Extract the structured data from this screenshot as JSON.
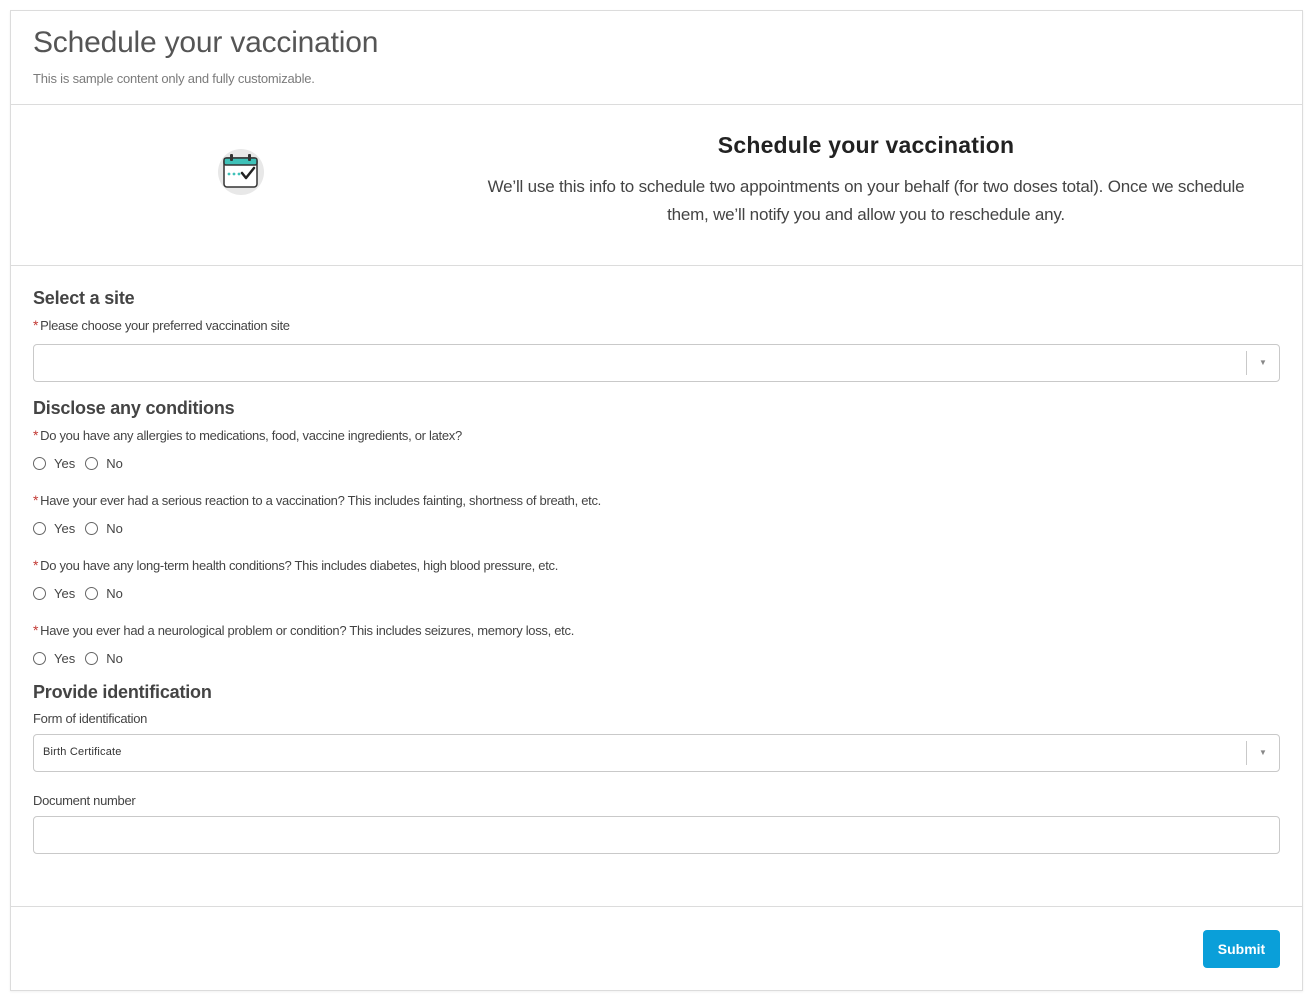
{
  "header": {
    "title": "Schedule your vaccination",
    "subtitle": "This is sample content only and fully customizable."
  },
  "hero": {
    "icon": "calendar-check-icon",
    "title": "Schedule your vaccination",
    "description": "We’ll use this info to schedule two appointments on your behalf (for two doses total). Once we schedule them, we’ll notify you and allow you to reschedule any."
  },
  "site_section": {
    "title": "Select a site",
    "required_mark": "*",
    "label": "Please choose your preferred vaccination site",
    "value": ""
  },
  "conditions_section": {
    "title": "Disclose any conditions",
    "questions": [
      {
        "label": "Do you have any allergies to medications, food, vaccine ingredients, or latex?",
        "yes": "Yes",
        "no": "No"
      },
      {
        "label": "Have your ever had a serious reaction to a vaccination? This includes fainting, shortness of breath, etc.",
        "yes": "Yes",
        "no": "No"
      },
      {
        "label": "Do you have any long-term health conditions? This includes diabetes, high blood pressure, etc.",
        "yes": "Yes",
        "no": "No"
      },
      {
        "label": "Have you ever had a neurological problem or condition? This includes seizures, memory loss, etc.",
        "yes": "Yes",
        "no": "No"
      }
    ]
  },
  "identification_section": {
    "title": "Provide identification",
    "form_label": "Form of identification",
    "form_value": "Birth Certificate",
    "doc_label": "Document number",
    "doc_value": ""
  },
  "footer": {
    "submit_label": "Submit"
  },
  "colors": {
    "accent": "#0a9fd9",
    "required": "#c23934",
    "icon_teal": "#3fc1b8"
  }
}
